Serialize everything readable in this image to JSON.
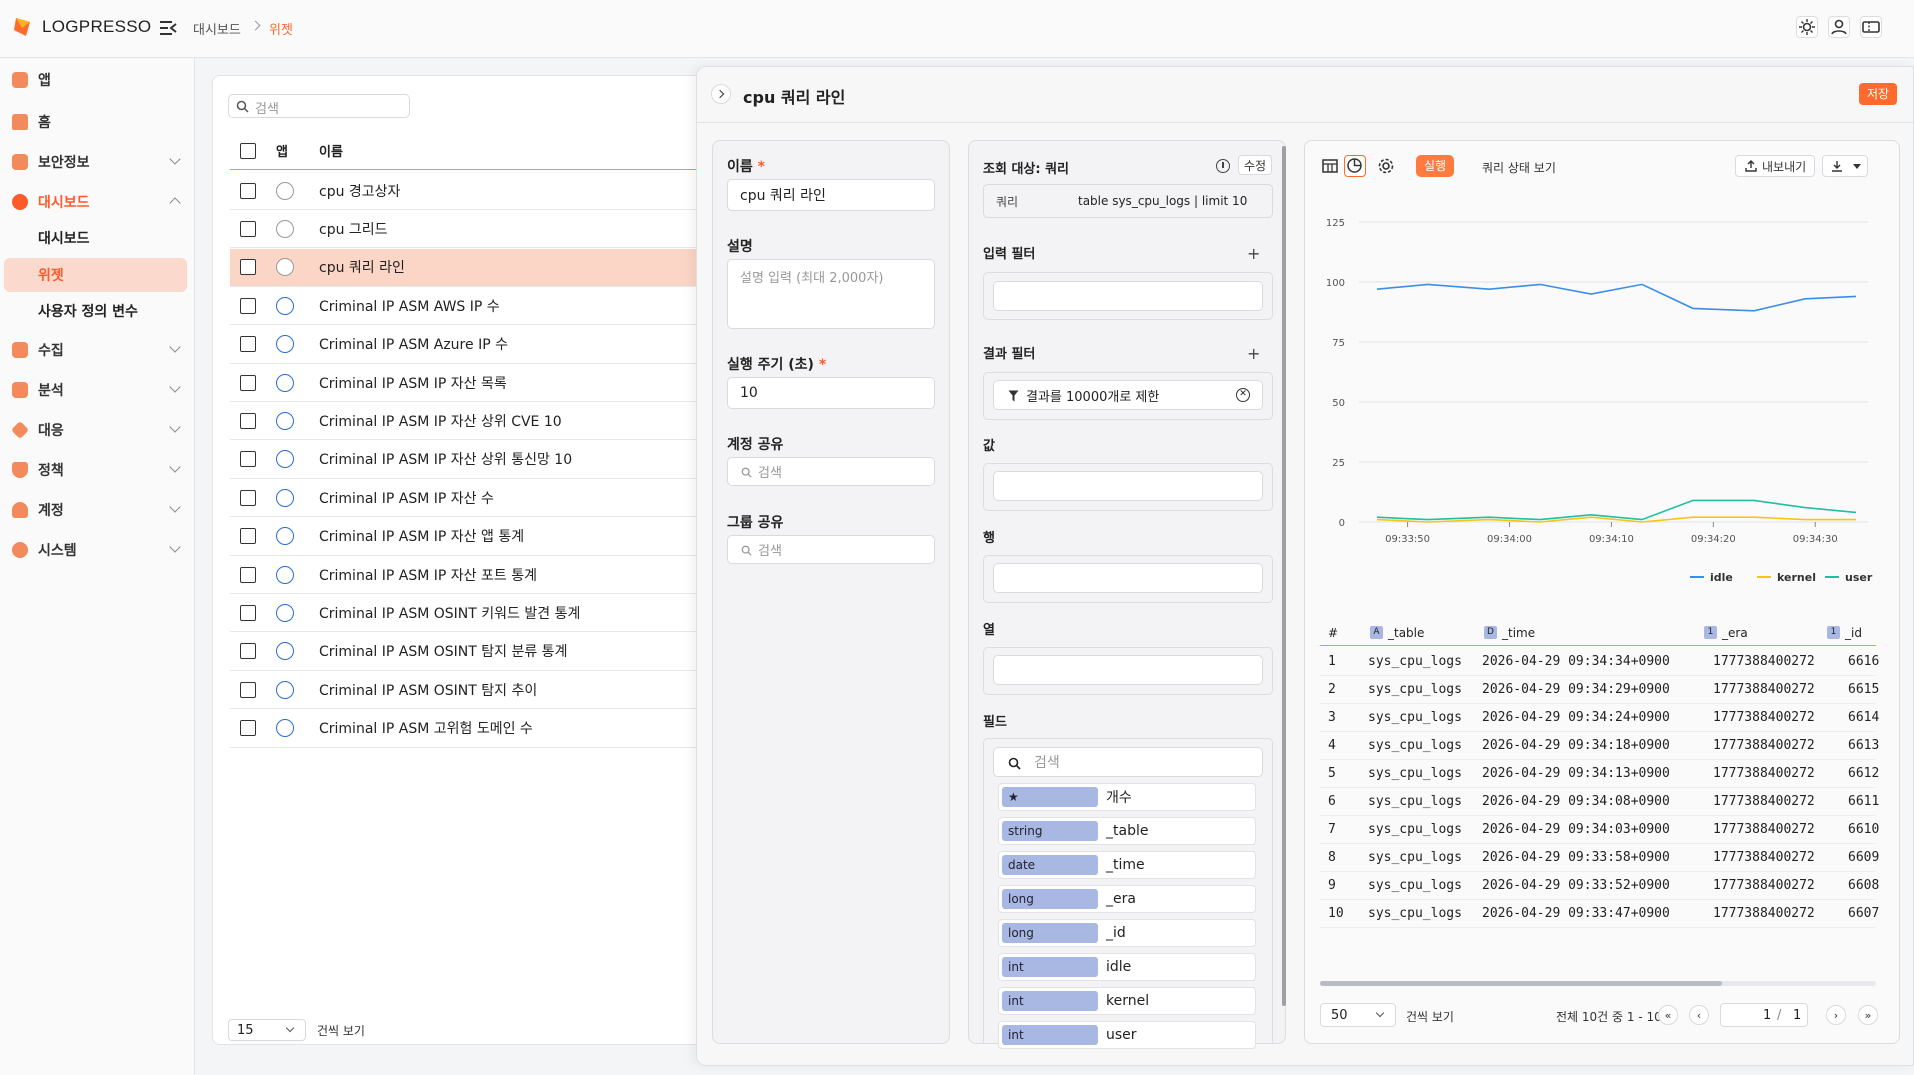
{
  "brand": {
    "name": "LOGPRESSO",
    "color": "#ff6b2c"
  },
  "breadcrumb": {
    "parent": "대시보드",
    "current": "위젯"
  },
  "sidebar": {
    "items": [
      {
        "label": "앱",
        "icon": "apps-icon",
        "color": "#f28a5c"
      },
      {
        "label": "홈",
        "icon": "home-icon",
        "color": "#f28a5c"
      },
      {
        "label": "보안정보",
        "icon": "megaphone-icon",
        "color": "#f28a5c"
      },
      {
        "label": "대시보드",
        "icon": "dashboard-icon",
        "color": "#ff5a2a",
        "active": true
      },
      {
        "label": "수집",
        "icon": "collect-icon",
        "color": "#f28a5c"
      },
      {
        "label": "분석",
        "icon": "analysis-icon",
        "color": "#f28a5c"
      },
      {
        "label": "대응",
        "icon": "response-icon",
        "color": "#f28a5c"
      },
      {
        "label": "정책",
        "icon": "shield-icon",
        "color": "#f28a5c"
      },
      {
        "label": "계정",
        "icon": "users-icon",
        "color": "#f28a5c"
      },
      {
        "label": "시스템",
        "icon": "gear-icon",
        "color": "#f28a5c"
      }
    ],
    "sub_items": [
      "대시보드",
      "위젯",
      "사용자 정의 변수"
    ]
  },
  "list": {
    "search_placeholder": "검색",
    "headers": {
      "app": "앱",
      "name": "이름"
    },
    "rows": [
      "cpu 경고상자",
      "cpu 그리드",
      "cpu 쿼리 라인",
      "Criminal IP ASM AWS IP 수",
      "Criminal IP ASM Azure IP 수",
      "Criminal IP ASM IP 자산 목록",
      "Criminal IP ASM IP 자산 상위 CVE 10",
      "Criminal IP ASM IP 자산 상위 통신망 10",
      "Criminal IP ASM IP 자산 수",
      "Criminal IP ASM IP 자산 앱 통계",
      "Criminal IP ASM IP 자산 포트 통계",
      "Criminal IP ASM OSINT 키워드 발견 통계",
      "Criminal IP ASM OSINT 탐지 분류 통계",
      "Criminal IP ASM OSINT 탐지 추이",
      "Criminal IP ASM 고위험 도메인 수"
    ],
    "selected_index": 2,
    "page_size": "15",
    "page_size_label": "건씩 보기"
  },
  "editor": {
    "title": "cpu 쿼리 라인",
    "save_label": "저장",
    "name_label": "이름",
    "name_value": "cpu 쿼리 라인",
    "desc_label": "설명",
    "desc_placeholder": "설명 입력 (최대 2,000자)",
    "interval_label": "실행 주기 (초)",
    "interval_value": "10",
    "account_share_label": "계정 공유",
    "group_share_label": "그룹 공유",
    "search_placeholder": "검색",
    "required_mark": "*"
  },
  "query": {
    "target_label": "조회 대상: 쿼리",
    "edit_label": "수정",
    "query_key": "쿼리",
    "query_value": "table sys_cpu_logs | limit 10",
    "input_filter_label": "입력 필터",
    "result_filter_label": "결과 필터",
    "result_filter_chip": "결과를 10000개로 제한",
    "value_label": "값",
    "row_label": "행",
    "column_label": "열",
    "field_label": "필드",
    "field_search_placeholder": "검색",
    "fields": [
      {
        "type": "★",
        "name": "개수"
      },
      {
        "type": "string",
        "name": "_table"
      },
      {
        "type": "date",
        "name": "_time"
      },
      {
        "type": "long",
        "name": "_era"
      },
      {
        "type": "long",
        "name": "_id"
      },
      {
        "type": "int",
        "name": "idle"
      },
      {
        "type": "int",
        "name": "kernel"
      },
      {
        "type": "int",
        "name": "user"
      }
    ]
  },
  "preview": {
    "run_label": "실행",
    "status_label": "쿼리 상태 보기",
    "export_label": "내보내기",
    "accent": "#ff7a3d"
  },
  "chart_data": {
    "type": "line",
    "x": [
      "09:33:47",
      "09:33:52",
      "09:33:58",
      "09:34:03",
      "09:34:08",
      "09:34:13",
      "09:34:18",
      "09:34:24",
      "09:34:29",
      "09:34:34"
    ],
    "xticks": [
      "09:33:50",
      "09:34:00",
      "09:34:10",
      "09:34:20",
      "09:34:30"
    ],
    "yticks": [
      0,
      25,
      50,
      75,
      100,
      125
    ],
    "ylim": [
      0,
      125
    ],
    "grid": true,
    "legend": "bottom-right",
    "series": [
      {
        "name": "idle",
        "color": "#3b8ee8",
        "values": [
          97,
          99,
          97,
          99,
          95,
          99,
          89,
          88,
          93,
          94
        ]
      },
      {
        "name": "kernel",
        "color": "#f5c518",
        "values": [
          1,
          0,
          1,
          0,
          2,
          0,
          2,
          2,
          1,
          1
        ]
      },
      {
        "name": "user",
        "color": "#1fbf9f",
        "values": [
          2,
          1,
          2,
          1,
          3,
          1,
          9,
          9,
          6,
          4
        ]
      }
    ]
  },
  "table": {
    "headers": [
      {
        "label": "#",
        "badge": ""
      },
      {
        "label": "_table",
        "badge": "A"
      },
      {
        "label": "_time",
        "badge": "D"
      },
      {
        "label": "_era",
        "badge": "1"
      },
      {
        "label": "_id",
        "badge": "1"
      }
    ],
    "rows": [
      [
        "1",
        "sys_cpu_logs",
        "2026-04-29 09:34:34+0900",
        "1777388400272",
        "6616"
      ],
      [
        "2",
        "sys_cpu_logs",
        "2026-04-29 09:34:29+0900",
        "1777388400272",
        "6615"
      ],
      [
        "3",
        "sys_cpu_logs",
        "2026-04-29 09:34:24+0900",
        "1777388400272",
        "6614"
      ],
      [
        "4",
        "sys_cpu_logs",
        "2026-04-29 09:34:18+0900",
        "1777388400272",
        "6613"
      ],
      [
        "5",
        "sys_cpu_logs",
        "2026-04-29 09:34:13+0900",
        "1777388400272",
        "6612"
      ],
      [
        "6",
        "sys_cpu_logs",
        "2026-04-29 09:34:08+0900",
        "1777388400272",
        "6611"
      ],
      [
        "7",
        "sys_cpu_logs",
        "2026-04-29 09:34:03+0900",
        "1777388400272",
        "6610"
      ],
      [
        "8",
        "sys_cpu_logs",
        "2026-04-29 09:33:58+0900",
        "1777388400272",
        "6609"
      ],
      [
        "9",
        "sys_cpu_logs",
        "2026-04-29 09:33:52+0900",
        "1777388400272",
        "6608"
      ],
      [
        "10",
        "sys_cpu_logs",
        "2026-04-29 09:33:47+0900",
        "1777388400272",
        "6607"
      ]
    ],
    "page_size": "50",
    "page_size_label": "건씩 보기",
    "summary": "전체 10건 중 1 - 10",
    "page_current": "1",
    "page_sep": "/",
    "page_total": "1"
  }
}
